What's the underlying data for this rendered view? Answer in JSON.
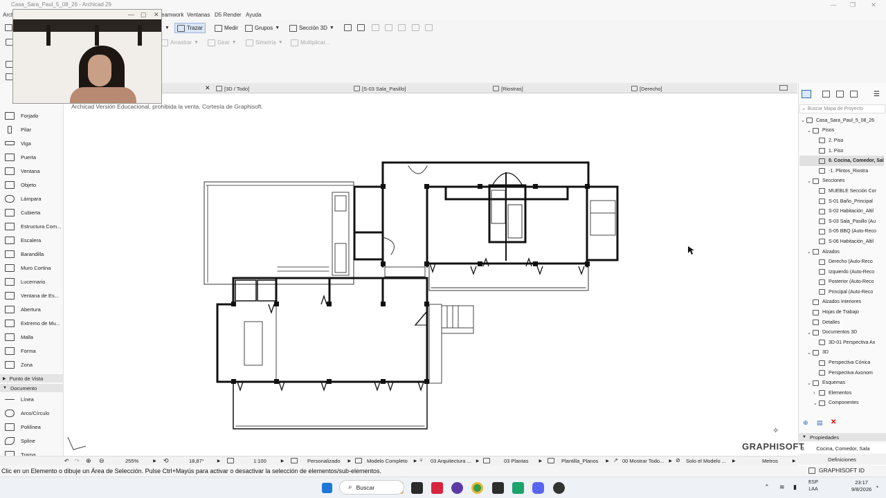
{
  "window": {
    "title": "Casa_Sara_Paul_5_08_26 - Archicad 29"
  },
  "menu": {
    "items": [
      "Arch",
      "Teamwork",
      "Ventanas",
      "D5 Render",
      "Ayuda"
    ]
  },
  "toolbar": {
    "trazar": "Trazar",
    "medir": "Medir",
    "grupos": "Grupos",
    "seccion3d": "Sección 3D",
    "arrastrar": "Arrastrar",
    "girar": "Girar",
    "simetria": "Simetría",
    "multiplicar": "Multiplicar..."
  },
  "tabs": [
    {
      "label": "[3D / Todo]"
    },
    {
      "label": "[S-03 Sala_Pasillo]"
    },
    {
      "label": "[Riostras]"
    },
    {
      "label": "[Derecho]"
    }
  ],
  "toolbox": {
    "tools": [
      "Forjado",
      "Pilar",
      "Viga",
      "Puerta",
      "Ventana",
      "Objeto",
      "Lámpara",
      "Cubierta",
      "Estructura Com...",
      "Escalera",
      "Barandilla",
      "Muro Cortina",
      "Lucernario",
      "Ventana de Es...",
      "Extremo de Mu...",
      "Malla",
      "Forma",
      "Zona"
    ],
    "section_view": "Punto de Vista",
    "section_doc": "Documento",
    "doc_tools": [
      "Línea",
      "Arco/Círculo",
      "Polilínea",
      "Spline",
      "Trama"
    ]
  },
  "canvas": {
    "watermark": "Archicad Versión Educacional, prohibida la venta. Cortesía de Graphisoft."
  },
  "navigator": {
    "search_placeholder": "Buscar Mapa de Proyecto",
    "items": [
      {
        "label": "Casa_Sara_Paul_5_08_26",
        "level": 0,
        "chev": "⌄",
        "icon": "house"
      },
      {
        "label": "Pisos",
        "level": 1,
        "chev": "⌄",
        "icon": "stack"
      },
      {
        "label": "2. Piso",
        "level": 2,
        "chev": "",
        "icon": "floor"
      },
      {
        "label": "1. Piso",
        "level": 2,
        "chev": "",
        "icon": "floor"
      },
      {
        "label": "0. Cocina, Comedor, Sala",
        "level": 2,
        "chev": "",
        "icon": "floor",
        "selected": true
      },
      {
        "label": "-1. Plintos_Riostra",
        "level": 2,
        "chev": "",
        "icon": "floor"
      },
      {
        "label": "Secciones",
        "level": 1,
        "chev": "⌄",
        "icon": "section"
      },
      {
        "label": "MUEBLE Sección Cor",
        "level": 2,
        "chev": "",
        "icon": "section"
      },
      {
        "label": "S-01 Baño_Principal",
        "level": 2,
        "chev": "",
        "icon": "section"
      },
      {
        "label": "S-02 Habitación_Altil",
        "level": 2,
        "chev": "",
        "icon": "section"
      },
      {
        "label": "S-03 Sala_Pasillo (Au",
        "level": 2,
        "chev": "",
        "icon": "section"
      },
      {
        "label": "S-05 BBQ (Auto-Reco",
        "level": 2,
        "chev": "",
        "icon": "section"
      },
      {
        "label": "S-06 Habitación_Altil",
        "level": 2,
        "chev": "",
        "icon": "section"
      },
      {
        "label": "Alzados",
        "level": 1,
        "chev": "⌄",
        "icon": "elev"
      },
      {
        "label": "Derecho (Auto-Reco",
        "level": 2,
        "chev": "",
        "icon": "elev"
      },
      {
        "label": "Izquierdo (Auto-Reco",
        "level": 2,
        "chev": "",
        "icon": "elev"
      },
      {
        "label": "Posterior (Auto-Reco",
        "level": 2,
        "chev": "",
        "icon": "elev"
      },
      {
        "label": "Principal (Auto-Reco",
        "level": 2,
        "chev": "",
        "icon": "elev"
      },
      {
        "label": "Alzados Interiores",
        "level": 1,
        "chev": "",
        "icon": "grid"
      },
      {
        "label": "Hojas de Trabajo",
        "level": 1,
        "chev": "",
        "icon": "sheet"
      },
      {
        "label": "Detalles",
        "level": 1,
        "chev": "",
        "icon": "detail"
      },
      {
        "label": "Documentos 3D",
        "level": 1,
        "chev": "⌄",
        "icon": "doc3d"
      },
      {
        "label": "3D-01 Perspectiva Ax",
        "level": 2,
        "chev": "",
        "icon": "doc3d"
      },
      {
        "label": "3D",
        "level": 1,
        "chev": "⌄",
        "icon": "cube"
      },
      {
        "label": "Perspectiva Cónica",
        "level": 2,
        "chev": "",
        "icon": "cube"
      },
      {
        "label": "Perspectiva Axonom",
        "level": 2,
        "chev": "",
        "icon": "cube"
      },
      {
        "label": "Esquemas",
        "level": 1,
        "chev": "⌄",
        "icon": "table"
      },
      {
        "label": "Elementos",
        "level": 2,
        "chev": "›",
        "icon": "table"
      },
      {
        "label": "Componentes",
        "level": 2,
        "chev": "⌄",
        "icon": "table"
      }
    ]
  },
  "properties": {
    "header": "Propiedades",
    "row_prefix": "0.",
    "row_value": "Cocina, Comedor, Sala",
    "definitions": "Definiciones"
  },
  "logo": "GRAPHISOFT",
  "bottombar": {
    "zoom": "255%",
    "angle": "18,87°",
    "scale": "1:100",
    "override": "Personalizado",
    "model": "Modelo Completo",
    "layer": "03 Arquitectura ...",
    "penset": "03 Plantas",
    "template": "Plantilla_Planos",
    "show": "00 Mostrar Todo...",
    "solo": "Solo el Modelo ...",
    "units": "Metros"
  },
  "status": {
    "message": "Clic en un Elemento o dibuje un Área de Selección. Pulse Ctrl+Mayús para activar o desactivar la selección de elementos/sub-elementos.",
    "graphisoft_id": "GRAPHISOFT ID"
  },
  "taskbar": {
    "search": "Buscar",
    "lang": "ESP",
    "lang2": "LAA",
    "time": "23:17",
    "date": "9/8/2026"
  }
}
